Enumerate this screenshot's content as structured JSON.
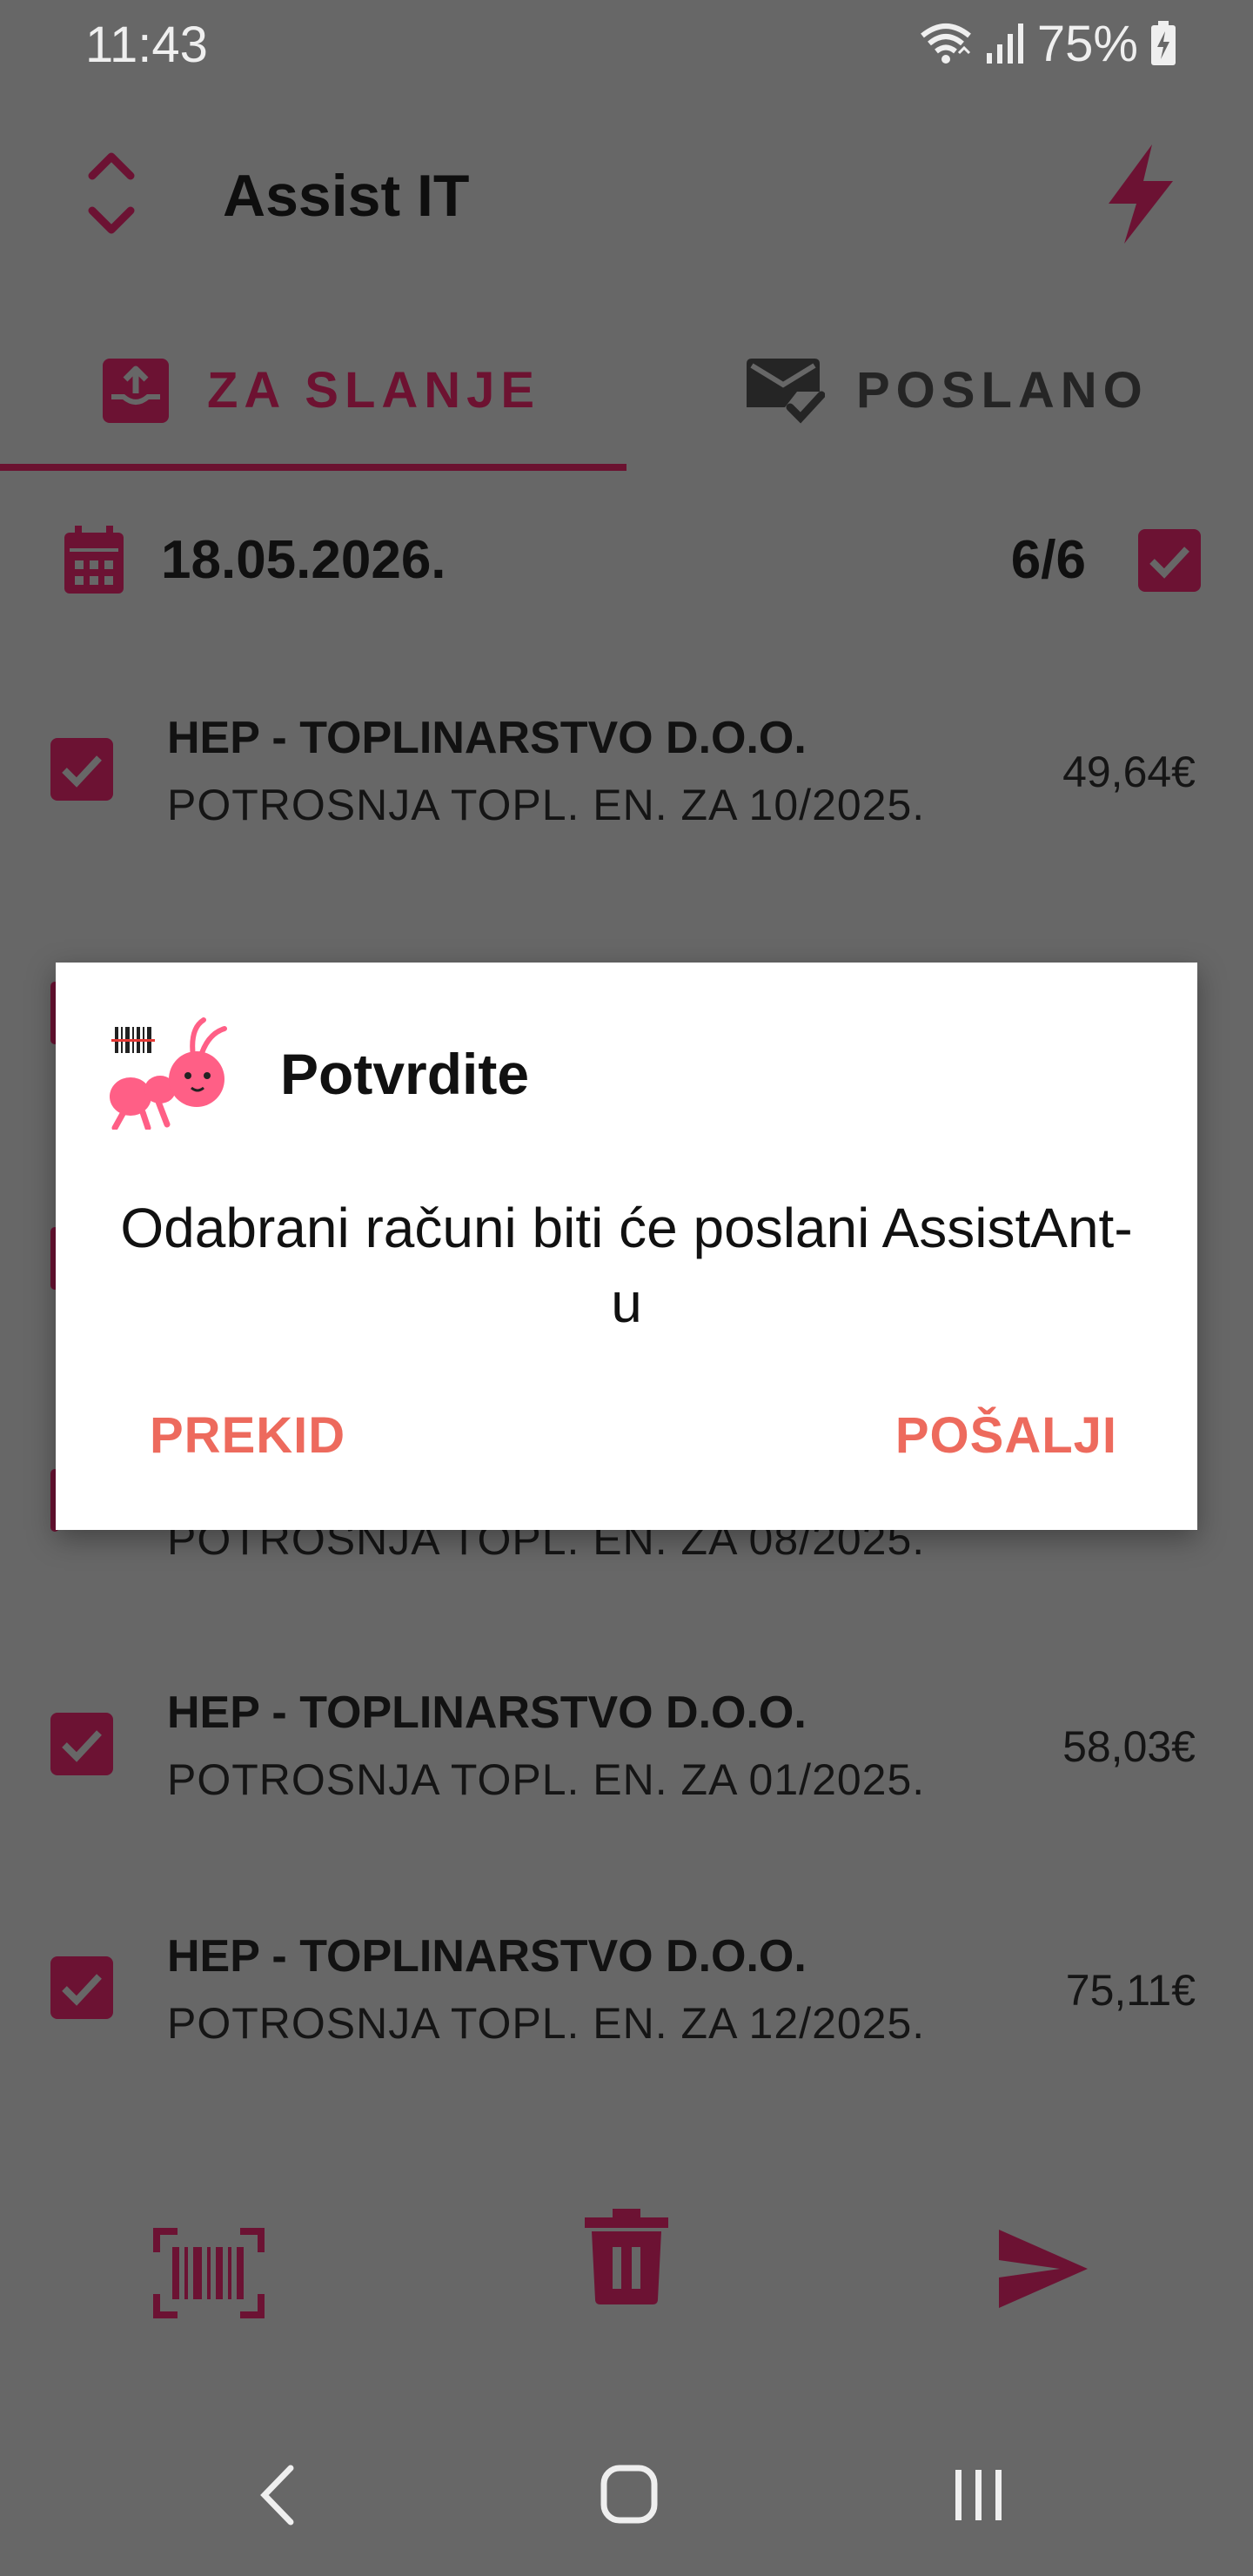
{
  "status_bar": {
    "time": "11:43",
    "battery": "75%"
  },
  "header": {
    "title": "Assist IT"
  },
  "tabs": [
    {
      "label": "ZA SLANJE",
      "active": true
    },
    {
      "label": "POSLANO",
      "active": false
    }
  ],
  "date_row": {
    "date": "18.05.2026.",
    "count": "6/6",
    "checked": true
  },
  "items": [
    {
      "title": "HEP - TOPLINARSTVO D.O.O.",
      "subtitle": "POTROSNJA TOPL. EN. ZA 10/2025.",
      "amount": "49,64€",
      "checked": true
    },
    {
      "title": "",
      "subtitle": "POTROSNJA TOPL. EN. ZA 08/2025.",
      "amount": "",
      "checked": true
    },
    {
      "title": "HEP - TOPLINARSTVO D.O.O.",
      "subtitle": "POTROSNJA TOPL. EN. ZA 01/2025.",
      "amount": "58,03€",
      "checked": true
    },
    {
      "title": "HEP - TOPLINARSTVO D.O.O.",
      "subtitle": "POTROSNJA TOPL. EN. ZA 12/2025.",
      "amount": "75,11€",
      "checked": true
    }
  ],
  "dialog": {
    "title": "Potvrdite",
    "message": "Odabrani računi biti će poslani AssistAnt-u",
    "cancel": "PREKID",
    "confirm": "POŠALJI"
  },
  "bottom_bar": {
    "icons": [
      "barcode-scan-icon",
      "trash-icon",
      "send-icon"
    ]
  },
  "nav_bar": {
    "icons": [
      "back-icon",
      "home-icon",
      "recents-icon"
    ]
  },
  "colors": {
    "accent": "#6c1233",
    "dialog_button": "#ed6a5d",
    "scrim": "#676767"
  }
}
